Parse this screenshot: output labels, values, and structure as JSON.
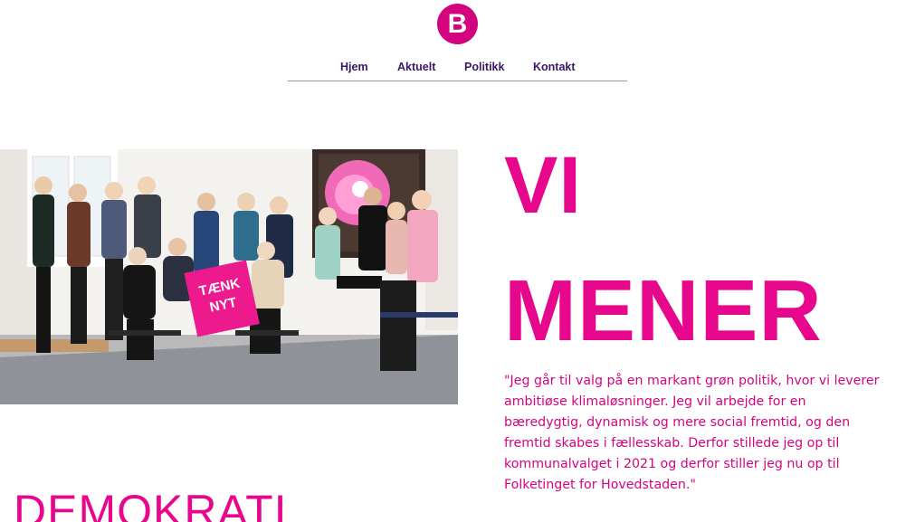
{
  "brand": {
    "logo_letter": "B",
    "accent_color": "#e6078c"
  },
  "nav": {
    "items": [
      {
        "label": "Hjem"
      },
      {
        "label": "Aktuelt"
      },
      {
        "label": "Politikk"
      },
      {
        "label": "Kontakt"
      }
    ]
  },
  "hero": {
    "image": {
      "sign_text": "TÆNK NYT"
    },
    "headline_line1": "VI",
    "headline_line2": "MENER",
    "quote": "\"Jeg går til valg på en markant grøn politik, hvor vi leverer ambitiøse klimaløsninger. Jeg vil arbejde for en bæredygtig, dynamisk og mere social fremtid, og den fremtid skabes i fællesskab. Derfor stillede jeg op til kommunalvalget i 2021 og derfor stiller jeg nu op til Folketinget for Hovedstaden.\""
  },
  "sections": {
    "next_title": "DEMOKRATI"
  }
}
